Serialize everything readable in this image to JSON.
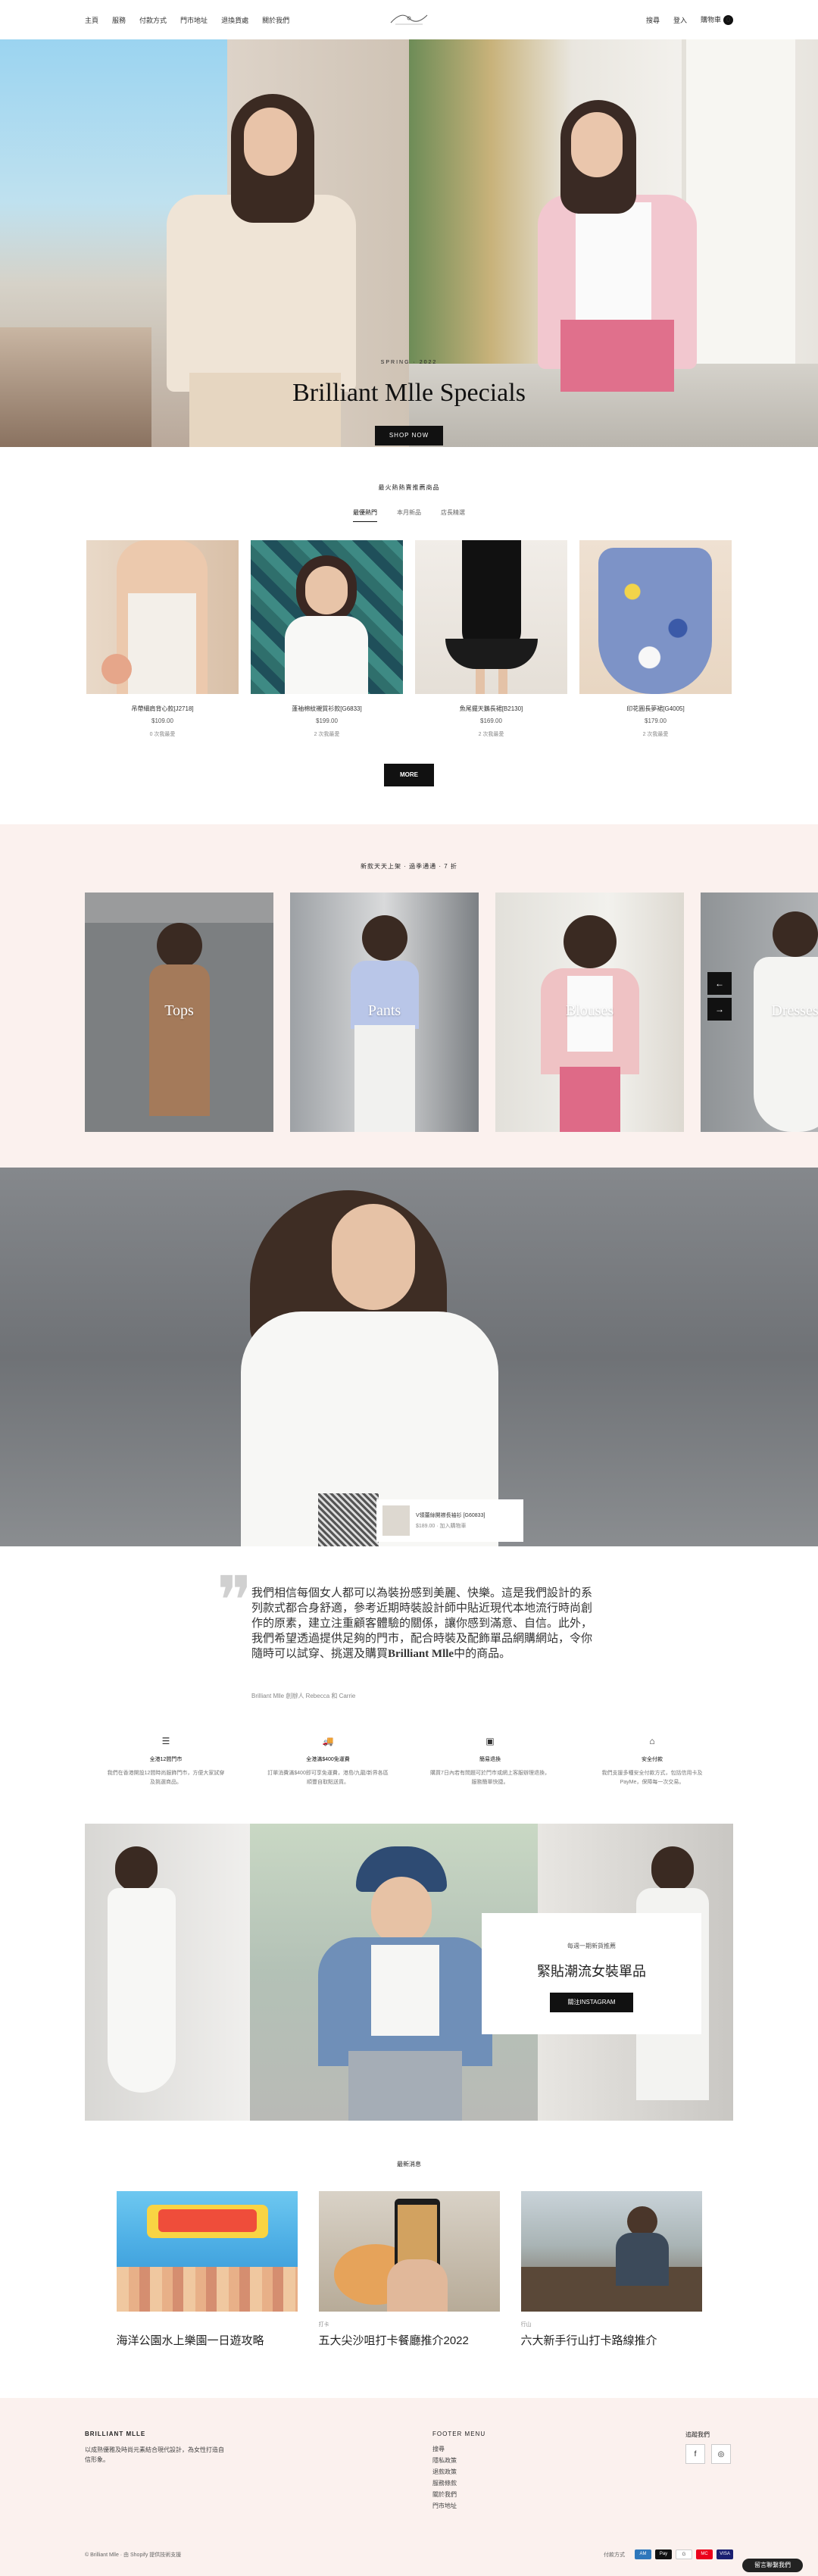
{
  "nav": {
    "left": [
      "主頁",
      "服務",
      "付款方式",
      "門市地址",
      "退換貨處",
      "關於我們"
    ],
    "right": [
      "搜尋",
      "登入",
      "購物車"
    ],
    "cart_count": "0"
  },
  "hero": {
    "eyebrow": "SPRING · 2022",
    "title": "Brilliant Mlle Specials",
    "button": "SHOP NOW"
  },
  "popular": {
    "title": "最火熱熱賣推薦商品",
    "tabs": [
      "最優熱門",
      "本月新品",
      "店長精選"
    ],
    "products": [
      {
        "name": "吊帶細肩背心款[J2718]",
        "price": "$109.00",
        "fav": "0 次我最愛"
      },
      {
        "name": "蓬袖棉紋襯質衫款[G6833]",
        "price": "$199.00",
        "fav": "2 次我最愛"
      },
      {
        "name": "魚尾擺天鵝長裙[B2130]",
        "price": "$169.00",
        "fav": "2 次我最愛"
      },
      {
        "name": "印花圓長夢裙[G4005]",
        "price": "$179.00",
        "fav": "2 次我最愛"
      }
    ],
    "more": "MORE"
  },
  "categories": {
    "title": "新款天天上架 · 過季通通 · 7 折",
    "items": [
      "Tops",
      "Pants",
      "Blouses",
      "Dresses"
    ],
    "prev": "←",
    "next": "→"
  },
  "feature": {
    "card_title": "V領蕾絲開襟長袖衫 [G60833]",
    "card_sub": "$189.00 · 加入購物車"
  },
  "quote": {
    "text": "我們相信每個女人都可以為裝扮感到美麗、快樂。這是我們設計的系列款式都合身舒適，參考近期時裝設計師中貼近現代本地流行時尚創作的原素，建立注重顧客體驗的關係，讓你感到滿意、自信。此外，我們希望透過提供足夠的門市，配合時裝及配飾單品網購網站，令你隨時可以試穿、挑選及購買",
    "brand": "Brilliant Mlle",
    "suffix": "中的商品。",
    "author": "Brilliant Mlle 創辦人 Rebecca 和 Carrie"
  },
  "features": [
    {
      "icon": "☰",
      "title": "全港12間門市",
      "desc": "我們在香港開設12間時尚服飾門市，方便大家試穿及挑選商品。"
    },
    {
      "icon": "🚚",
      "title": "全港滿$400免運費",
      "desc": "訂單消費滿$400即可享免運費，港島/九龍/新界各區順豐自取點送貨。"
    },
    {
      "icon": "▣",
      "title": "簡易退換",
      "desc": "購買7日內若有問題可於門市或網上客服辦理退換，服務簡單快捷。"
    },
    {
      "icon": "⌂",
      "title": "安全付款",
      "desc": "我們支援多種安全付款方式，包括信用卡及PayMe，保障每一次交易。"
    }
  ],
  "instagram": {
    "eyebrow": "每週一期新貨推薦",
    "title": "緊貼潮流女裝單品",
    "button": "關注INSTAGRAM"
  },
  "blog": {
    "title": "最新消息",
    "posts": [
      {
        "cat": "",
        "title": "海洋公園水上樂園一日遊攻略"
      },
      {
        "cat": "打卡",
        "title": "五大尖沙咀打卡餐廳推介2022"
      },
      {
        "cat": "行山",
        "title": "六大新手行山打卡路線推介"
      }
    ]
  },
  "footer": {
    "brand": "BRILLIANT MLLE",
    "desc": "以成熟優雅及時尚元素結合現代設計，為女性打造自信形象。",
    "menu_title": "FOOTER MENU",
    "menu": [
      "搜尋",
      "隱私政策",
      "退款政策",
      "服務條款",
      "關於我們",
      "門市地址"
    ],
    "follow": "追蹤我們",
    "copy": "© Brilliant Mlle · 由 Shopify 提供技術支援",
    "pay_label": "付款方式",
    "chat": "留言聯繫我們"
  },
  "colors": {
    "accent": "#111111",
    "section_bg": "#fbf1ee"
  }
}
